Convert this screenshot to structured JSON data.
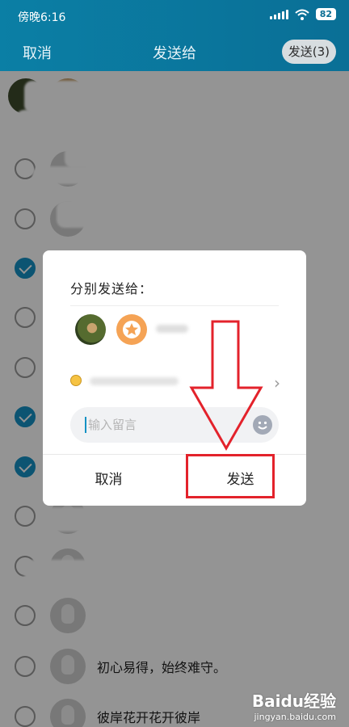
{
  "status_bar": {
    "time": "傍晚6:16",
    "battery": "82"
  },
  "header": {
    "cancel": "取消",
    "title": "发送给",
    "send_button": "发送(3)"
  },
  "list": {
    "rows": [
      {
        "name": "",
        "checked": true
      },
      {
        "name": "",
        "checked": false
      },
      {
        "name": "",
        "checked": false
      },
      {
        "name": "",
        "checked": true
      },
      {
        "name": "",
        "checked": false
      },
      {
        "name": "",
        "checked": false
      },
      {
        "name": "",
        "checked": true
      },
      {
        "name": "",
        "checked": true
      },
      {
        "name": "",
        "checked": false
      },
      {
        "name": "",
        "checked": false
      },
      {
        "name": "",
        "checked": false
      },
      {
        "name": "初心易得，始终难守。",
        "checked": false
      },
      {
        "name": "彼岸花开花开彼岸",
        "checked": false
      }
    ]
  },
  "dialog": {
    "title": "分别发送给：",
    "recipients": [
      {
        "icon": "hummingbird-avatar"
      },
      {
        "icon": "star-avatar"
      }
    ],
    "comment_placeholder": "输入留言",
    "cancel": "取消",
    "send": "发送"
  },
  "colors": {
    "accent": "#1592c4",
    "header": "#0b7fa5",
    "annotation": "#e3222b"
  },
  "watermark": {
    "brand": "Baidu经验",
    "url": "jingyan.baidu.com"
  }
}
